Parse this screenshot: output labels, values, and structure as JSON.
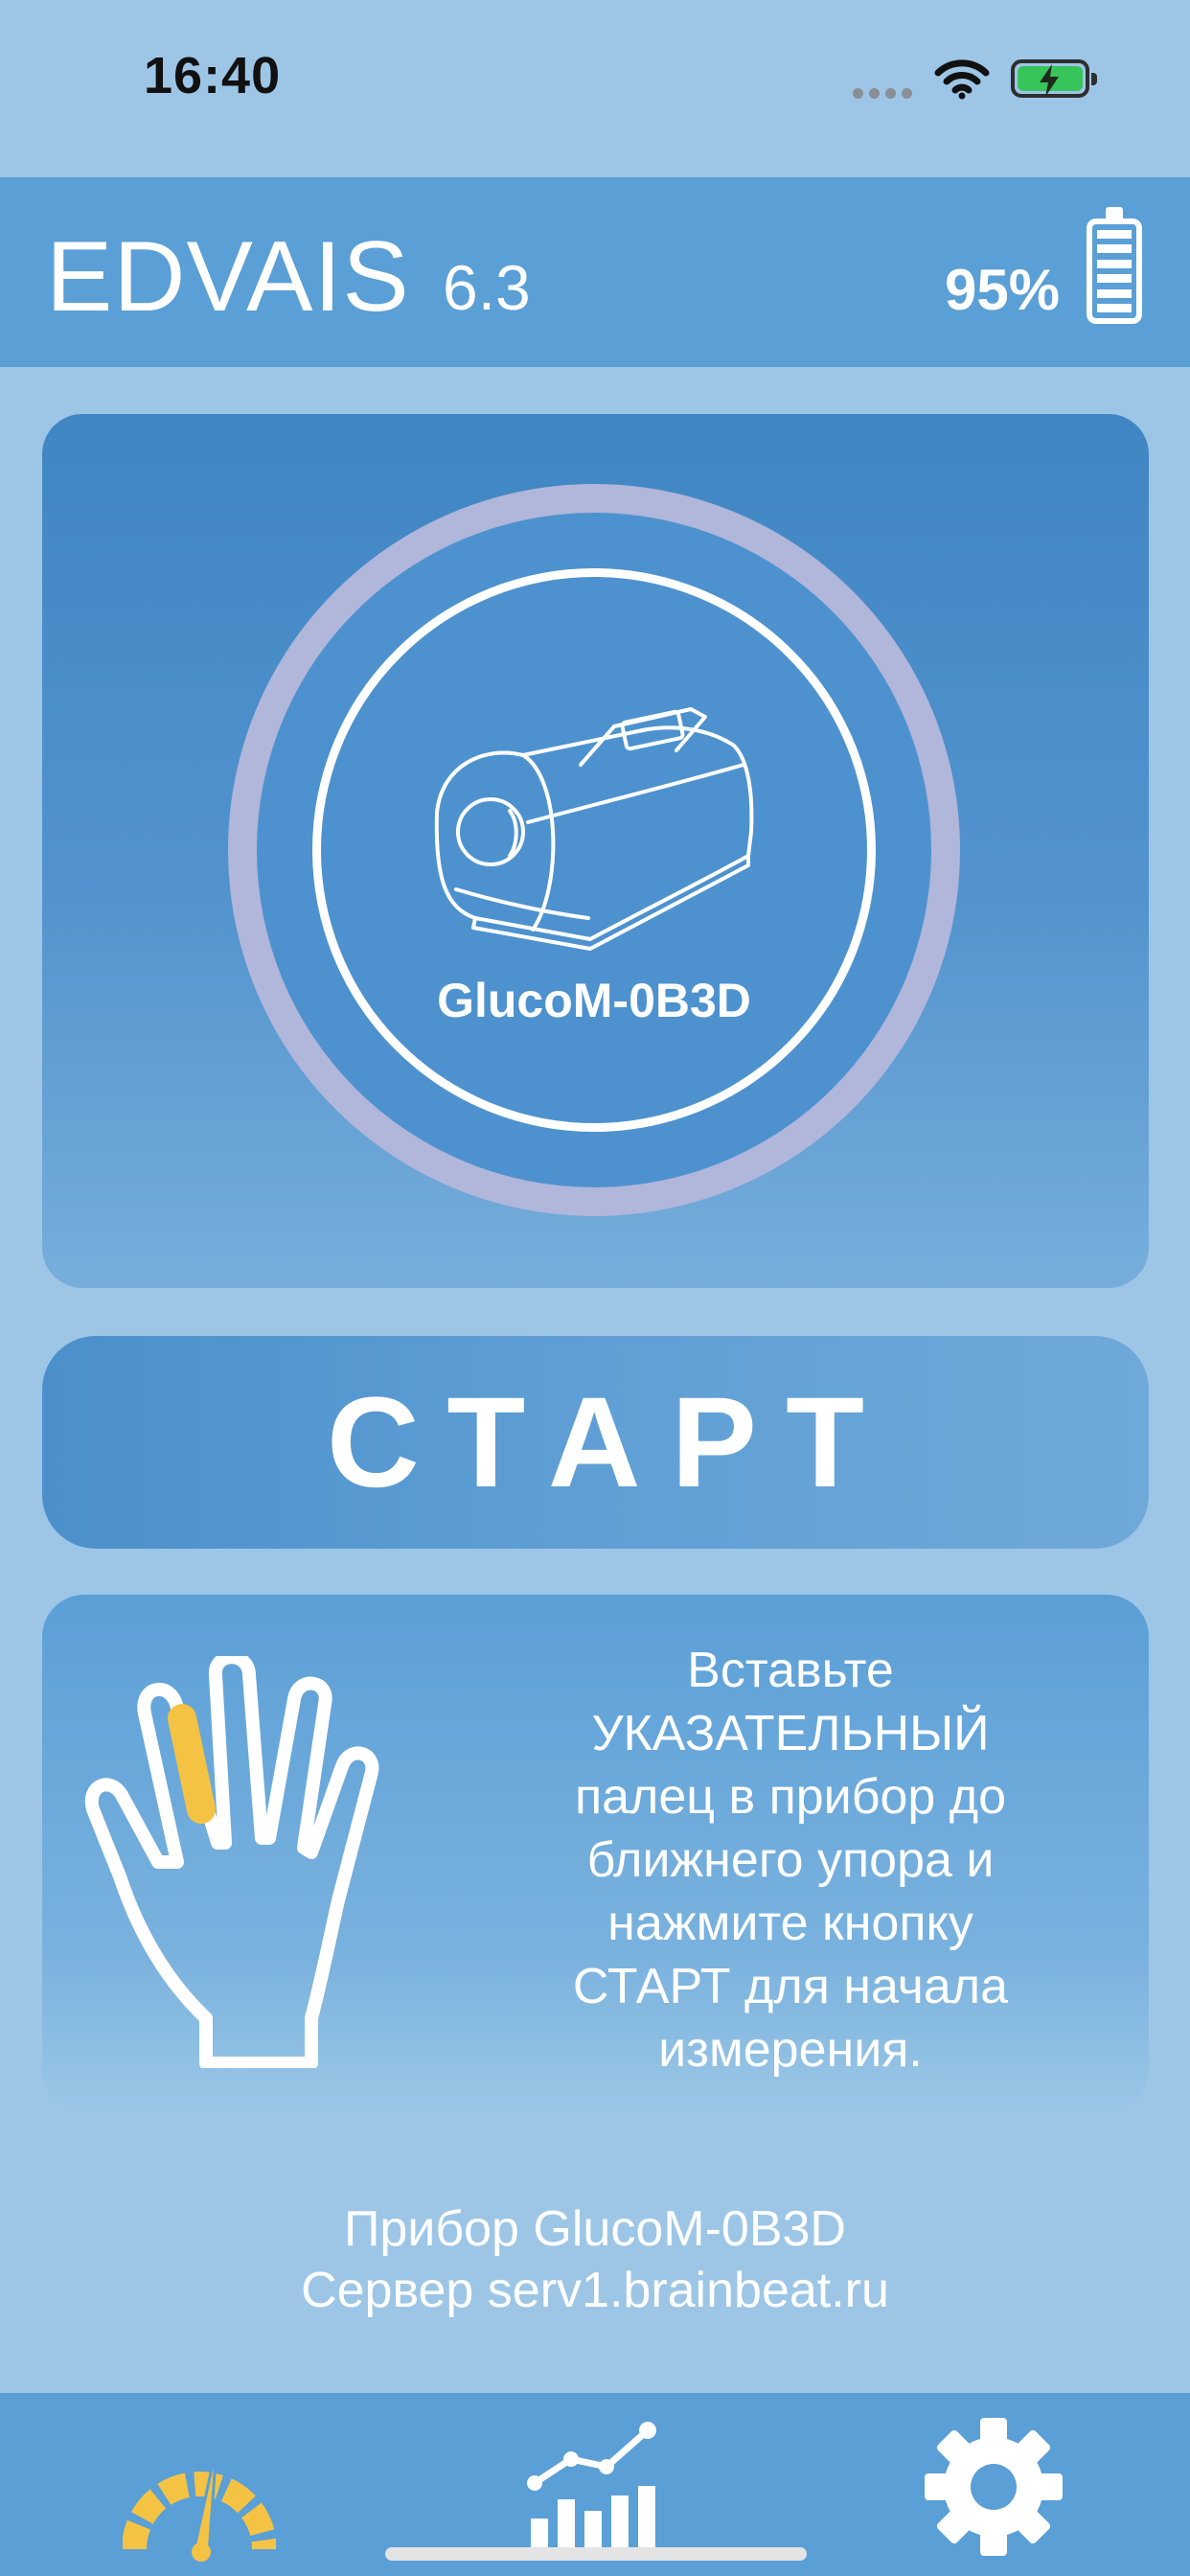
{
  "status_bar": {
    "time": "16:40",
    "signal_icon": "signal-dots-icon",
    "wifi_icon": "wifi-icon",
    "battery_icon": "charging-battery-icon"
  },
  "header": {
    "title": "EDVAIS",
    "version": "6.3",
    "battery_percent": "95%",
    "battery_icon": "battery-full-icon"
  },
  "device": {
    "name": "GlucoM-0B3D",
    "icon": "glucometer-device-icon"
  },
  "start_button": {
    "label": "СТАРТ"
  },
  "instruction": {
    "hand_icon": "hand-index-finger-icon",
    "lines": [
      "Вставьте",
      "УКАЗАТЕЛЬНЫЙ",
      "палец в прибор до",
      "ближнего упора и",
      "нажмите кнопку",
      "СТАРТ для начала",
      "измерения."
    ]
  },
  "info": {
    "device_line": "Прибор GlucoM-0B3D",
    "server_line": "Сервер serv1.brainbeat.ru"
  },
  "tabbar": {
    "tabs": [
      {
        "icon": "speedometer-icon",
        "active": true
      },
      {
        "icon": "chart-icon",
        "active": false
      },
      {
        "icon": "gear-icon",
        "active": false
      }
    ]
  },
  "colors": {
    "background": "#9dc6e6",
    "header": "#5a9fd6",
    "accent_yellow": "#f5c343",
    "ring": "#b1b6db"
  }
}
